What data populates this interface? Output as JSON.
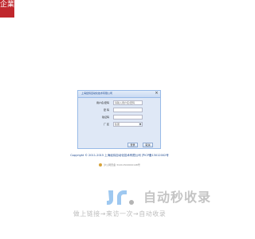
{
  "corner_logo": {
    "text": "企業"
  },
  "dialog": {
    "title": "上海经纬自动化技术有限公司",
    "close_glyph": "×",
    "fields": [
      {
        "label": "用户名/密码",
        "value": "请输入用户名/密码"
      },
      {
        "label": "密 码",
        "value": ""
      },
      {
        "label": "验证码",
        "value": ""
      },
      {
        "label": "厂 区",
        "value": "集团",
        "arrow": "▼"
      }
    ],
    "login_label": "登录",
    "cancel_label": "取消"
  },
  "footer": {
    "copyright": "Copyright © 2011-2015 上海经纬自动化技术有限公司 沪ICP备13012002号",
    "beian": "沪公网安备 31011502000148号"
  },
  "watermark": {
    "brand": "自动秒收录",
    "tagline": "做上链接→来访一次→自动收录"
  }
}
